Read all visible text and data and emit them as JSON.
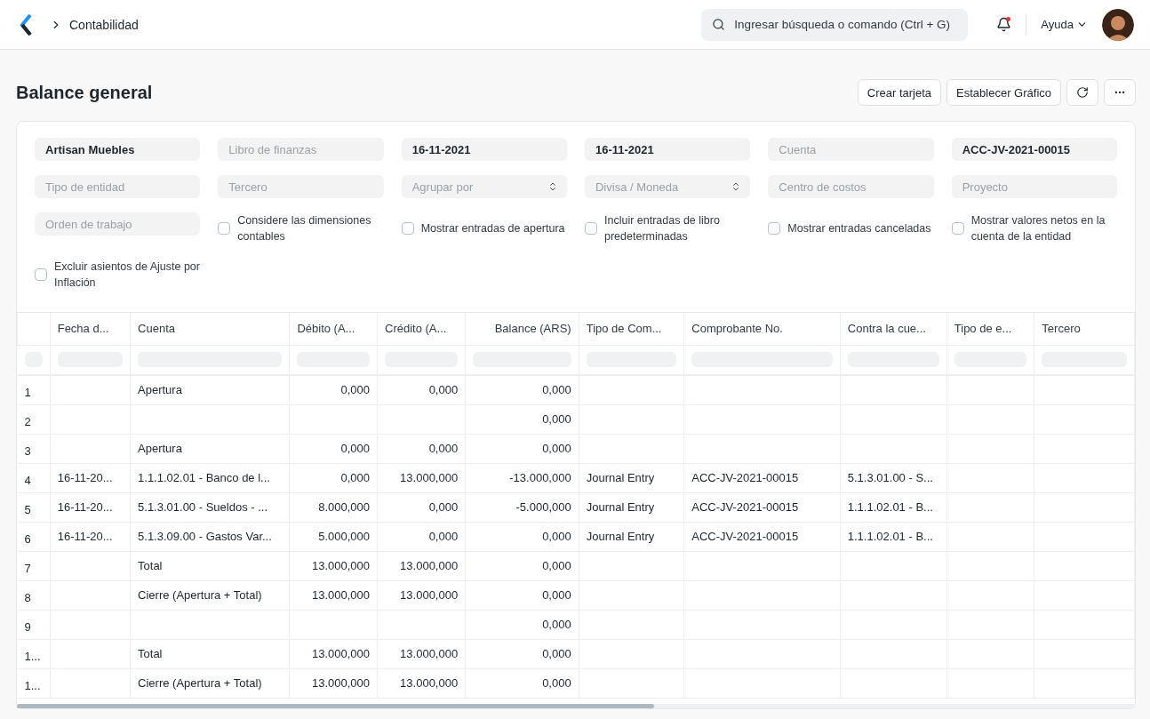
{
  "navbar": {
    "breadcrumb": "Contabilidad",
    "search": {
      "placeholder": "Ingresar búsqueda o comando (Ctrl + G)"
    },
    "notifications": {
      "unread": true
    },
    "help": "Ayuda"
  },
  "page": {
    "title": "Balance general",
    "actions": [
      "Crear tarjeta",
      "Establecer Gráfico"
    ]
  },
  "filters": [
    {
      "kind": "field",
      "value": "Artisan Muebles"
    },
    {
      "kind": "field",
      "placeholder": "Libro de finanzas"
    },
    {
      "kind": "field",
      "value": "16-11-2021"
    },
    {
      "kind": "field",
      "value": "16-11-2021"
    },
    {
      "kind": "field",
      "placeholder": "Cuenta"
    },
    {
      "kind": "field",
      "value": "ACC-JV-2021-00015"
    },
    {
      "kind": "field",
      "placeholder": "Tipo de entidad"
    },
    {
      "kind": "field",
      "placeholder": "Tercero"
    },
    {
      "kind": "select",
      "placeholder": "Agrupar por"
    },
    {
      "kind": "select",
      "placeholder": "Divisa / Moneda"
    },
    {
      "kind": "field",
      "placeholder": "Centro de costos"
    },
    {
      "kind": "field",
      "placeholder": "Proyecto"
    },
    {
      "kind": "field",
      "placeholder": "Orden de trabajo"
    },
    {
      "kind": "checkbox",
      "label": "Considere las dimensiones contables",
      "checked": false
    },
    {
      "kind": "checkbox",
      "label": "Mostrar entradas de apertura",
      "checked": false
    },
    {
      "kind": "checkbox",
      "label": "Incluir entradas de libro predeterminadas",
      "checked": false
    },
    {
      "kind": "checkbox",
      "label": "Mostrar entradas canceladas",
      "checked": false
    },
    {
      "kind": "checkbox",
      "label": "Mostrar valores netos en la cuenta de la entidad",
      "checked": false
    },
    {
      "kind": "checkbox",
      "label": "Excluir asientos de Ajuste por Inflación",
      "checked": false
    }
  ],
  "table": {
    "columns": [
      {
        "label": "Fecha d..."
      },
      {
        "label": "Cuenta"
      },
      {
        "label": "Débito (A..."
      },
      {
        "label": "Crédito (A..."
      },
      {
        "label": "Balance (ARS)"
      },
      {
        "label": "Tipo de Com..."
      },
      {
        "label": "Comprobante No."
      },
      {
        "label": "Contra la cue..."
      },
      {
        "label": "Tipo de e..."
      },
      {
        "label": "Tercero"
      }
    ],
    "rows": [
      {
        "number": "1",
        "cells": [
          null,
          "Apertura",
          "0,000",
          "0,000",
          "0,000",
          null,
          null,
          null,
          null,
          null
        ]
      },
      {
        "number": "2",
        "cells": [
          null,
          null,
          null,
          null,
          "0,000",
          null,
          null,
          null,
          null,
          null
        ]
      },
      {
        "number": "3",
        "cells": [
          null,
          "Apertura",
          "0,000",
          "0,000",
          "0,000",
          null,
          null,
          null,
          null,
          null
        ]
      },
      {
        "number": "4",
        "cells": [
          "16-11-20...",
          "1.1.1.02.01 - Banco de l...",
          "0,000",
          "13.000,000",
          "-13.000,000",
          "Journal Entry",
          "ACC-JV-2021-00015",
          "5.1.3.01.00 - S...",
          null,
          null
        ]
      },
      {
        "number": "5",
        "cells": [
          "16-11-20...",
          "5.1.3.01.00 - Sueldos - ...",
          "8.000,000",
          "0,000",
          "-5.000,000",
          "Journal Entry",
          "ACC-JV-2021-00015",
          "1.1.1.02.01 - B...",
          null,
          null
        ]
      },
      {
        "number": "6",
        "cells": [
          "16-11-20...",
          "5.1.3.09.00 - Gastos Var...",
          "5.000,000",
          "0,000",
          "0,000",
          "Journal Entry",
          "ACC-JV-2021-00015",
          "1.1.1.02.01 - B...",
          null,
          null
        ]
      },
      {
        "number": "7",
        "cells": [
          null,
          "Total",
          "13.000,000",
          "13.000,000",
          "0,000",
          null,
          null,
          null,
          null,
          null
        ]
      },
      {
        "number": "8",
        "cells": [
          null,
          "Cierre (Apertura + Total)",
          "13.000,000",
          "13.000,000",
          "0,000",
          null,
          null,
          null,
          null,
          null
        ]
      },
      {
        "number": "9",
        "cells": [
          null,
          null,
          null,
          null,
          "0,000",
          null,
          null,
          null,
          null,
          null
        ]
      },
      {
        "number": "1...",
        "cells": [
          null,
          "Total",
          "13.000,000",
          "13.000,000",
          "0,000",
          null,
          null,
          null,
          null,
          null
        ]
      },
      {
        "number": "1...",
        "cells": [
          null,
          "Cierre (Apertura + Total)",
          "13.000,000",
          "13.000,000",
          "0,000",
          null,
          null,
          null,
          null,
          null
        ]
      }
    ]
  }
}
